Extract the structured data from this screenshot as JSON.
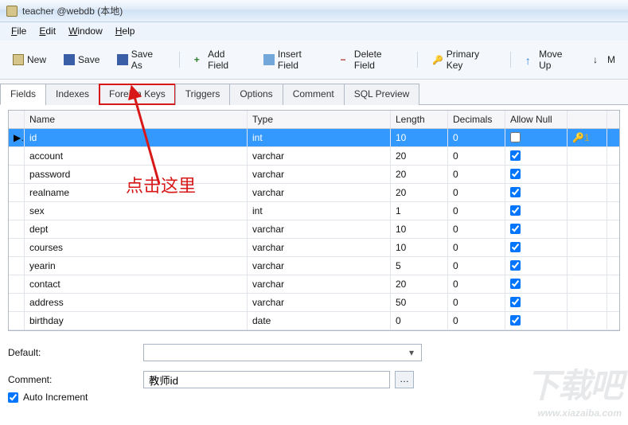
{
  "window": {
    "title": "teacher @webdb (本地)"
  },
  "menu": {
    "file": "File",
    "edit": "Edit",
    "window": "Window",
    "help": "Help"
  },
  "toolbar": {
    "new": "New",
    "save": "Save",
    "saveas": "Save As",
    "addfield": "Add Field",
    "insertfield": "Insert Field",
    "deletefield": "Delete Field",
    "primarykey": "Primary Key",
    "moveup": "Move Up",
    "movedown": "M"
  },
  "tabs": {
    "fields": "Fields",
    "indexes": "Indexes",
    "foreign": "Foreign Keys",
    "triggers": "Triggers",
    "options": "Options",
    "comment": "Comment",
    "sql": "SQL Preview"
  },
  "grid": {
    "headers": {
      "name": "Name",
      "type": "Type",
      "length": "Length",
      "decimals": "Decimals",
      "allownull": "Allow Null"
    },
    "rows": [
      {
        "name": "id",
        "type": "int",
        "length": "10",
        "decimals": "0",
        "allow": false,
        "pk": "1"
      },
      {
        "name": "account",
        "type": "varchar",
        "length": "20",
        "decimals": "0",
        "allow": true
      },
      {
        "name": "password",
        "type": "varchar",
        "length": "20",
        "decimals": "0",
        "allow": true
      },
      {
        "name": "realname",
        "type": "varchar",
        "length": "20",
        "decimals": "0",
        "allow": true
      },
      {
        "name": "sex",
        "type": "int",
        "length": "1",
        "decimals": "0",
        "allow": true
      },
      {
        "name": "dept",
        "type": "varchar",
        "length": "10",
        "decimals": "0",
        "allow": true
      },
      {
        "name": "courses",
        "type": "varchar",
        "length": "10",
        "decimals": "0",
        "allow": true
      },
      {
        "name": "yearin",
        "type": "varchar",
        "length": "5",
        "decimals": "0",
        "allow": true
      },
      {
        "name": "contact",
        "type": "varchar",
        "length": "20",
        "decimals": "0",
        "allow": true
      },
      {
        "name": "address",
        "type": "varchar",
        "length": "50",
        "decimals": "0",
        "allow": true
      },
      {
        "name": "birthday",
        "type": "date",
        "length": "0",
        "decimals": "0",
        "allow": true
      }
    ]
  },
  "form": {
    "default_label": "Default:",
    "default_value": "",
    "comment_label": "Comment:",
    "comment_value": "教师id",
    "auto_inc_label": "Auto Increment",
    "auto_inc": true
  },
  "annotation": "点击这里",
  "watermark": {
    "big": "下载吧",
    "small": "www.xiazaiba.com"
  }
}
